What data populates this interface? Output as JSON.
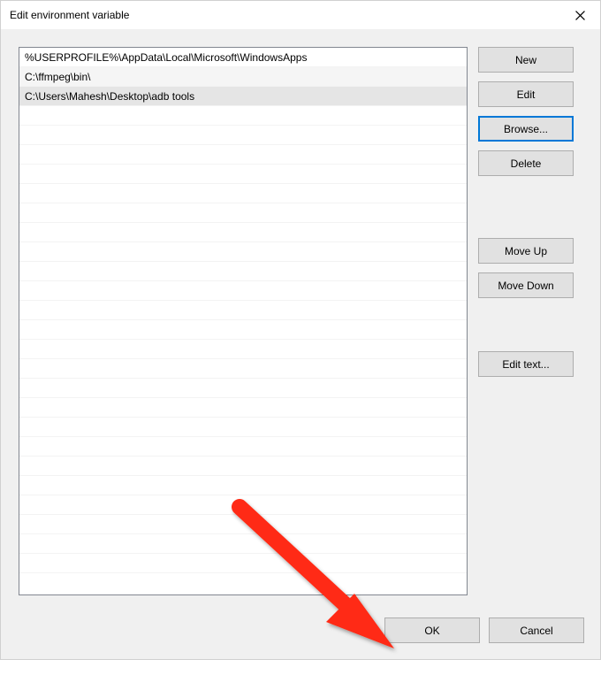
{
  "title": "Edit environment variable",
  "paths": [
    "%USERPROFILE%\\AppData\\Local\\Microsoft\\WindowsApps",
    "C:\\ffmpeg\\bin\\",
    "C:\\Users\\Mahesh\\Desktop\\adb tools"
  ],
  "selected_index": 2,
  "buttons": {
    "new": "New",
    "edit": "Edit",
    "browse": "Browse...",
    "delete": "Delete",
    "move_up": "Move Up",
    "move_down": "Move Down",
    "edit_text": "Edit text...",
    "ok": "OK",
    "cancel": "Cancel"
  }
}
